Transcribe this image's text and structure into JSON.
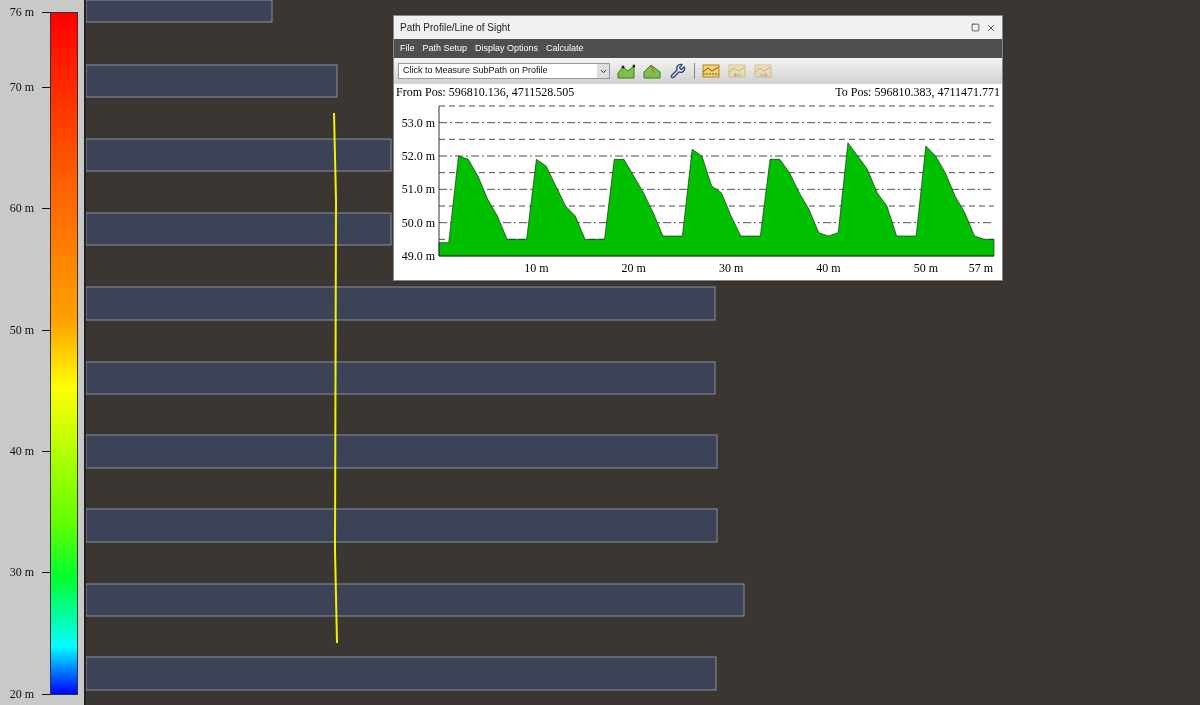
{
  "legend": {
    "ticks": [
      "76 m",
      "70 m",
      "60 m",
      "50 m",
      "40 m",
      "30 m",
      "20 m"
    ]
  },
  "window": {
    "title": "Path Profile/Line of Sight"
  },
  "menu": [
    "File",
    "Path Setup",
    "Display Options",
    "Calculate"
  ],
  "toolbar": {
    "mode_dropdown": "Click to Measure SubPath on Profile",
    "tools": [
      {
        "kind": "profile",
        "disabled": false
      },
      {
        "kind": "terrain",
        "disabled": false
      },
      {
        "kind": "wrench",
        "disabled": false
      },
      {
        "kind": "marker",
        "disabled": false
      },
      {
        "kind": "prev",
        "disabled": true
      },
      {
        "kind": "next",
        "disabled": true
      }
    ]
  },
  "profile": {
    "from_pos": "From Pos: 596810.136, 4711528.505",
    "to_pos": "To Pos: 596810.383, 4711471.771",
    "chart_data": {
      "type": "area",
      "x": [
        0,
        1,
        2,
        3,
        4,
        5,
        6,
        7,
        8,
        9,
        10,
        11,
        12,
        13,
        14,
        15,
        16,
        17,
        18,
        19,
        20,
        21,
        22,
        23,
        24,
        25,
        26,
        27,
        28,
        29,
        30,
        31,
        32,
        33,
        34,
        35,
        36,
        37,
        38,
        39,
        40,
        41,
        42,
        43,
        44,
        45,
        46,
        47,
        48,
        49,
        50,
        51,
        52,
        53,
        54,
        55,
        56,
        57
      ],
      "series": [
        {
          "color": "#00c000",
          "values": [
            49.4,
            49.4,
            52.0,
            51.9,
            51.4,
            50.7,
            50.2,
            49.5,
            49.5,
            49.5,
            51.9,
            51.7,
            51.1,
            50.5,
            50.2,
            49.5,
            49.5,
            49.5,
            51.9,
            51.9,
            51.4,
            50.9,
            50.3,
            49.6,
            49.6,
            49.6,
            52.2,
            52.0,
            51.1,
            50.9,
            50.2,
            49.6,
            49.6,
            49.6,
            51.9,
            51.9,
            51.5,
            50.9,
            50.4,
            49.7,
            49.6,
            49.7,
            52.4,
            52.0,
            51.6,
            50.9,
            50.5,
            49.6,
            49.6,
            49.6,
            52.3,
            52.0,
            51.5,
            50.8,
            50.3,
            49.6,
            49.5,
            49.5
          ]
        }
      ],
      "grid": true,
      "xlim": [
        0,
        57
      ],
      "ylim": [
        49.0,
        53.5
      ],
      "xticks": [
        {
          "value": 10,
          "label": "10 m"
        },
        {
          "value": 20,
          "label": "20 m"
        },
        {
          "value": 30,
          "label": "30 m"
        },
        {
          "value": 40,
          "label": "40 m"
        },
        {
          "value": 50,
          "label": "50 m"
        },
        {
          "value": 57,
          "label": "57 m"
        }
      ],
      "yticks": [
        {
          "value": 49,
          "label": "49.0 m"
        },
        {
          "value": 50,
          "label": "50.0 m"
        },
        {
          "value": 51,
          "label": "51.0 m"
        },
        {
          "value": 52,
          "label": "52.0 m"
        },
        {
          "value": 53,
          "label": "53.0 m"
        }
      ]
    }
  }
}
